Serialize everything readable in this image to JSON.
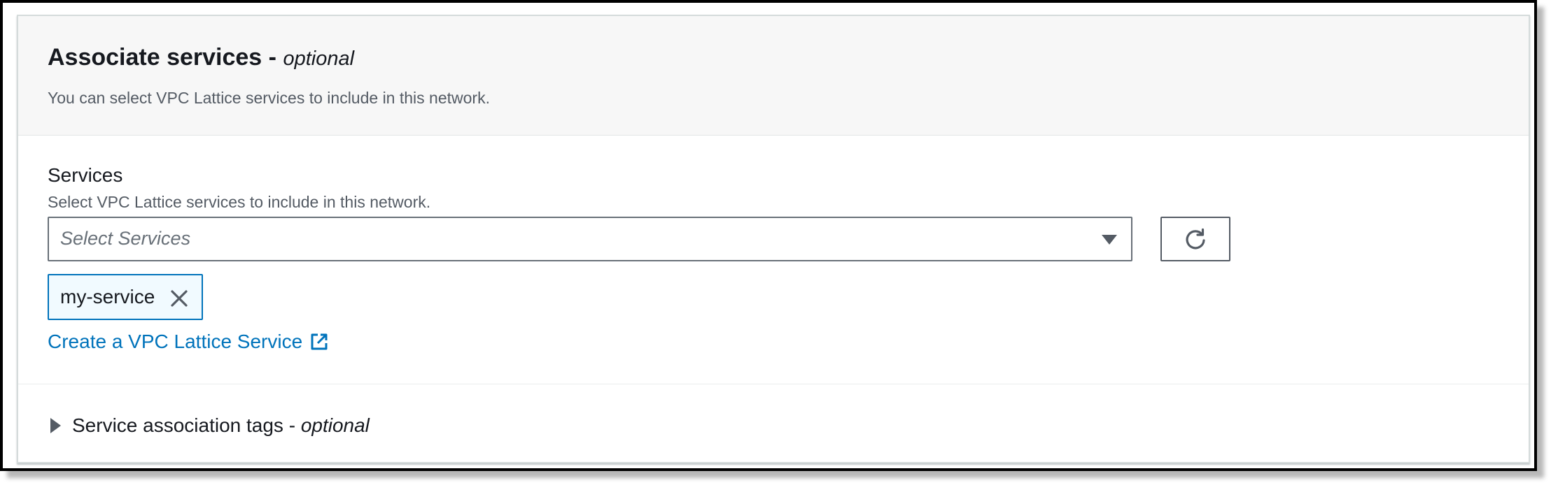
{
  "section": {
    "title": "Associate services - ",
    "title_optional": "optional",
    "description": "You can select VPC Lattice services to include in this network."
  },
  "services_field": {
    "label": "Services",
    "description": "Select VPC Lattice services to include in this network.",
    "select_placeholder": "Select Services",
    "refresh_icon": "refresh-icon",
    "selected_tokens": [
      {
        "label": "my-service",
        "dismiss_icon": "close-icon"
      }
    ],
    "create_link": "Create a VPC Lattice Service",
    "create_link_icon": "external-link-icon"
  },
  "tags_expander": {
    "label": "Service association tags - ",
    "label_optional": "optional",
    "expanded": false
  },
  "colors": {
    "link": "#0073bb",
    "header_background": "#f7f7f7",
    "token_background": "#f1faff"
  }
}
